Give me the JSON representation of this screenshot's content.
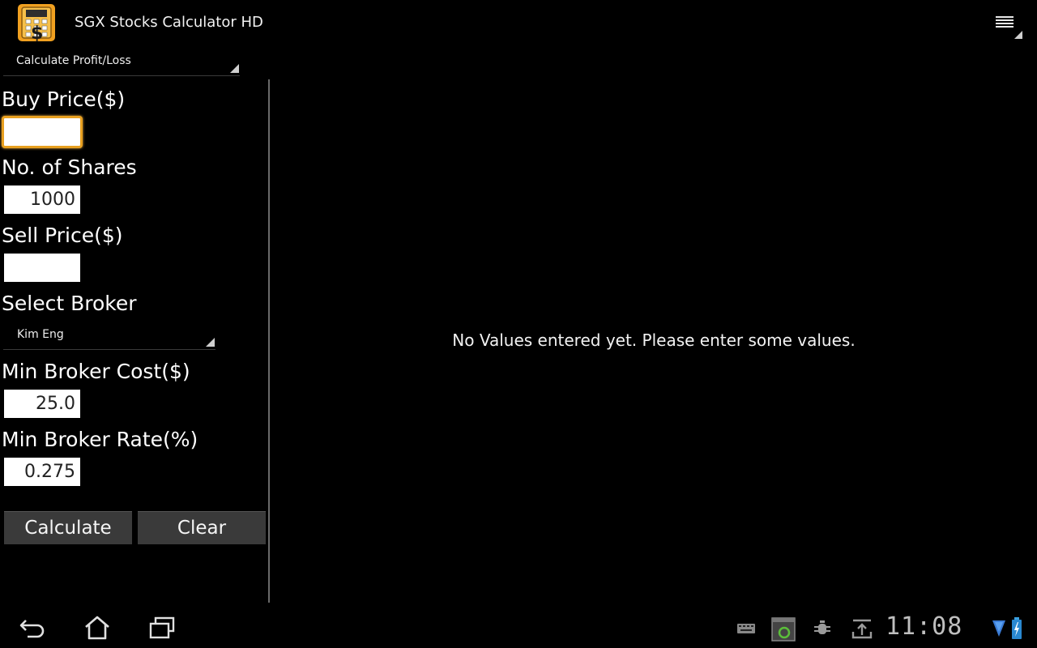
{
  "app": {
    "title": "SGX Stocks Calculator HD"
  },
  "mode_spinner": {
    "selected": "Calculate Profit/Loss"
  },
  "form": {
    "buy_price": {
      "label": "Buy Price($)",
      "value": ""
    },
    "shares": {
      "label": "No. of Shares",
      "value": "1000"
    },
    "sell_price": {
      "label": "Sell Price($)",
      "value": ""
    },
    "broker": {
      "label": "Select Broker",
      "selected": "Kim Eng"
    },
    "min_cost": {
      "label": "Min Broker Cost($)",
      "value": "25.0"
    },
    "min_rate": {
      "label": "Min Broker Rate(%)",
      "value": "0.275"
    }
  },
  "buttons": {
    "calculate": "Calculate",
    "clear": "Clear"
  },
  "result": {
    "message": "No Values entered yet. Please enter some values."
  },
  "status_bar": {
    "time": "11:08"
  },
  "colors": {
    "background": "#000000",
    "focus": "#e8a020",
    "button": "#3a3a3a",
    "icon_gold": "#f0a020"
  },
  "icons": [
    "calculator-app-icon",
    "overflow-menu-icon",
    "back-icon",
    "home-icon",
    "recent-apps-icon",
    "keyboard-icon",
    "screenshot-icon",
    "usb-debug-icon",
    "download-icon",
    "wifi-icon",
    "battery-icon"
  ]
}
